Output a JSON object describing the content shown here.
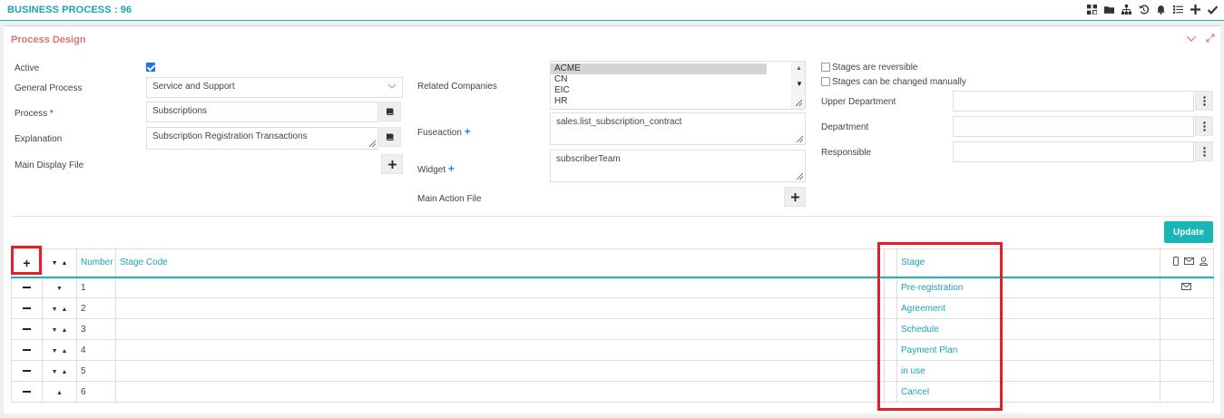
{
  "header": {
    "title": "BUSINESS PROCESS : 96",
    "icons": [
      "grid-icon",
      "folder-icon",
      "sitemap-icon",
      "history-icon",
      "bell-icon",
      "list-icon",
      "plus-icon",
      "check-icon"
    ]
  },
  "panel": {
    "title": "Process Design",
    "tools": [
      "chevron-down-icon",
      "expand-icon"
    ]
  },
  "form": {
    "active_label": "Active",
    "active_checked": true,
    "general_process_label": "General Process",
    "general_process_value": "Service and Support",
    "process_label": "Process *",
    "process_value": "Subscriptions",
    "explanation_label": "Explanation",
    "explanation_value": "Subscription Registration Transactions",
    "main_display_file_label": "Main Display File",
    "related_companies_label": "Related Companies",
    "companies": [
      "ACME",
      "CN",
      "EIC",
      "HR"
    ],
    "fuseaction_label": "Fuseaction",
    "fuseaction_value": "sales.list_subscription_contract",
    "widget_label": "Widget",
    "widget_value": "subscriberTeam",
    "main_action_file_label": "Main Action File",
    "reversible_label": "Stages are reversible",
    "reversible_checked": false,
    "manual_label": "Stages can be changed manually",
    "manual_checked": false,
    "upper_department_label": "Upper Department",
    "department_label": "Department",
    "responsible_label": "Responsible",
    "update_label": "Update"
  },
  "table": {
    "headers": {
      "number": "Number",
      "stage_code": "Stage Code",
      "stage": "Stage"
    },
    "rows": [
      {
        "number": "1",
        "stage_code": "",
        "stage": "Pre-registration",
        "up": false,
        "down": true,
        "mail": true
      },
      {
        "number": "2",
        "stage_code": "",
        "stage": "Agreement",
        "up": true,
        "down": true,
        "mail": false
      },
      {
        "number": "3",
        "stage_code": "",
        "stage": "Schedule",
        "up": true,
        "down": true,
        "mail": false
      },
      {
        "number": "4",
        "stage_code": "",
        "stage": "Payment Plan",
        "up": true,
        "down": true,
        "mail": false
      },
      {
        "number": "5",
        "stage_code": "",
        "stage": "in use",
        "up": true,
        "down": true,
        "mail": false
      },
      {
        "number": "6",
        "stage_code": "",
        "stage": "Cancel",
        "up": true,
        "down": false,
        "mail": false
      }
    ]
  },
  "colors": {
    "accent": "#1ab5b5",
    "panel_title": "#e0726f",
    "highlight": "#e3202a"
  }
}
